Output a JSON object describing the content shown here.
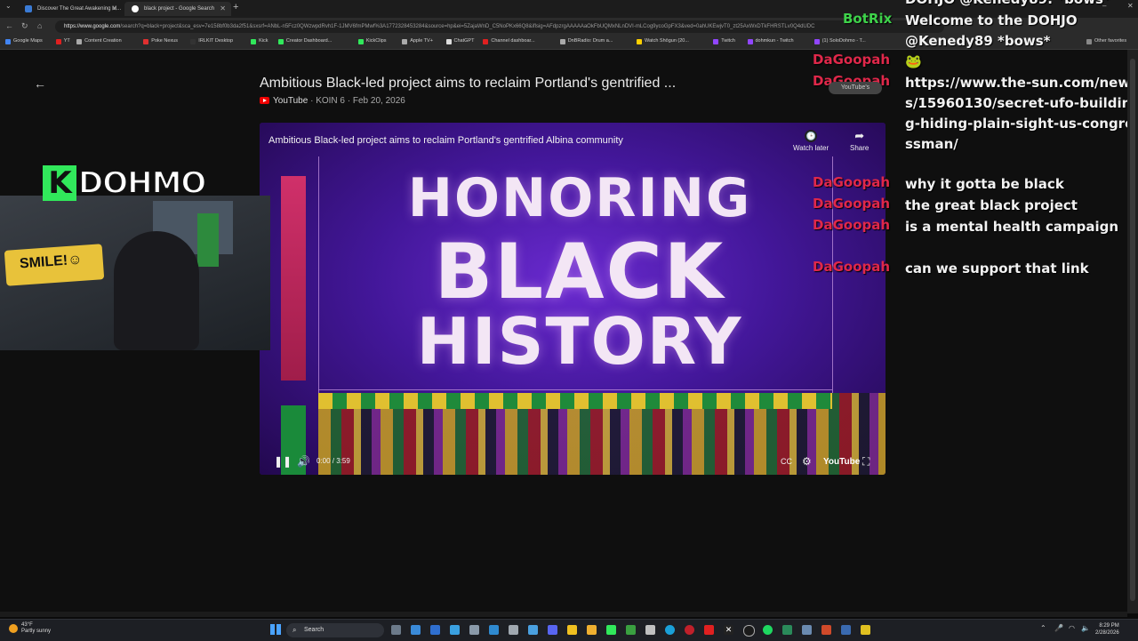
{
  "browser": {
    "tabs": [
      {
        "title": "Discover The Great Awakening M...",
        "active": false
      },
      {
        "title": "black project - Google Search",
        "active": true
      }
    ],
    "url_host": "https://www.google.com",
    "url_rest": "/search?q=black+project&sca_esv=7e158bf0b3da2f51&sxsrf=ANbL-n5Fcz0QWzwpdRvh1F-1JMV6fmPMwf%3A1772328453284&source=hp&ei=5ZajaWnD_C5NoPKx66Q8&iflsig=AFdpzrgAAAAAaOkFbUQMxNLnDVI-mLCog9ycoGpFX3&ved=0ahUKEwjvT0_zt25AxWxDTkFHRSTLv0Q4dUDC",
    "bookmarks": [
      "Google Maps",
      "YT",
      "Content Creation",
      "Poke Nexus",
      "IRLKIT Desktop",
      "Kick",
      "Creator Dashboard...",
      "KickClips",
      "Apple TV+",
      "ChatGPT",
      "Channel dashboar...",
      "DnBRadio: Drum a...",
      "Watch Shōgun (20...",
      "Twitch",
      "dohmkun - Twitch",
      "(1) SoloDohmo - T...",
      "Other favorites"
    ]
  },
  "video": {
    "title": "Ambitious Black-led project aims to reclaim Portland's gentrified ...",
    "source": "YouTube",
    "channel": "KOIN 6",
    "date": "Feb 20, 2026",
    "player_title": "Ambitious Black-led project aims to reclaim Portland's gentrified Albina community",
    "overlay_line1": "HONORING",
    "overlay_line2": "BLACK",
    "overlay_line3": "HISTORY",
    "watch_later": "Watch later",
    "share": "Share",
    "time": "0:00 / 3:59",
    "yt_logo": "YouTube"
  },
  "stream": {
    "logo_text": "DOHMO",
    "logo_k": "K",
    "poster_text": "SMILE!☺",
    "yt_badge": "YouTube's"
  },
  "chat": {
    "messages": [
      {
        "user": "BotRix",
        "text": "Welcome to the DOHJO @Kenedy89 *bows*",
        "bot": true
      },
      {
        "user": "DaGoopah",
        "text": "🐸"
      },
      {
        "user": "DaGoopah",
        "text": "https://www.the-sun.com/news/15960130/secret-ufo-building-hiding-plain-sight-us-congressman/"
      },
      {
        "user": "DaGoopah",
        "text": "why it gotta be black"
      },
      {
        "user": "DaGoopah",
        "text": "the great black project"
      },
      {
        "user": "DaGoopah",
        "text": "is a mental health campaign"
      },
      {
        "user": "DaGoopah",
        "text": "can we support that link"
      }
    ],
    "top_partial": "DOHJO @Kenedy89: *bows*"
  },
  "taskbar": {
    "weather_temp": "43°F",
    "weather_desc": "Partly sunny",
    "search_label": "Search",
    "time": "8:29 PM",
    "date": "2/28/2026"
  },
  "colors": {
    "chat_user": "#e0284a",
    "bot_user": "#3ed24a",
    "kick_green": "#31e85b"
  }
}
